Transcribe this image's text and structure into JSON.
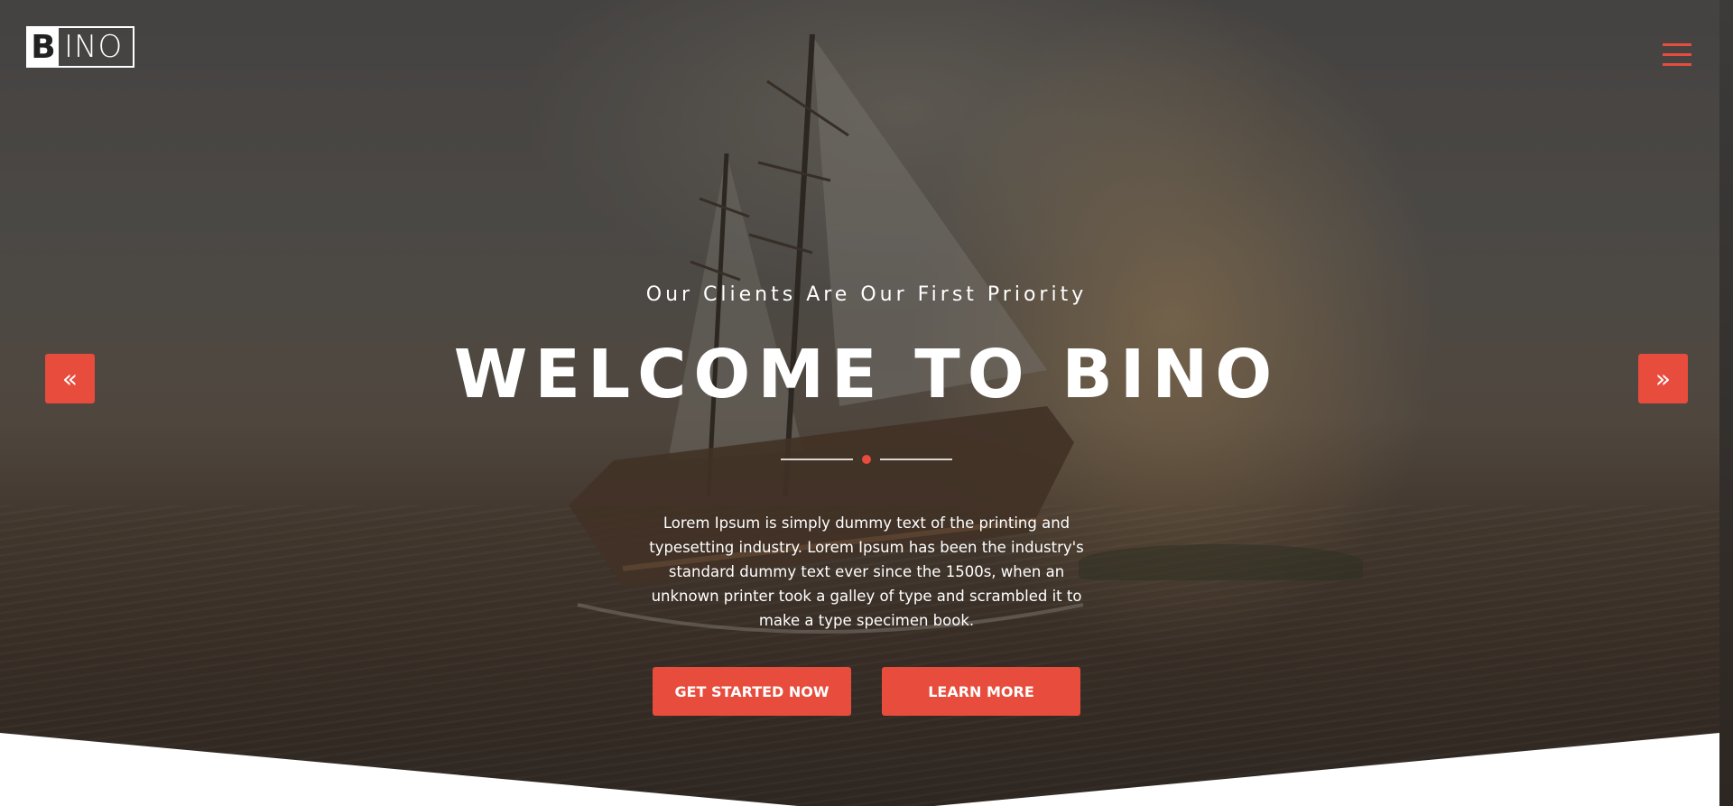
{
  "brand": {
    "logo_letter": "B",
    "logo_rest": "INO"
  },
  "nav": {
    "menu_icon": "hamburger-icon"
  },
  "slider": {
    "prev_icon": "double-chevron-left-icon",
    "next_icon": "double-chevron-right-icon",
    "prev_glyph": "«",
    "next_glyph": "»"
  },
  "hero": {
    "subtitle": "Our Clients Are Our First Priority",
    "title": "WELCOME TO BINO",
    "description": "Lorem Ipsum is simply dummy text of the printing and typesetting industry. Lorem Ipsum has been the industry's standard dummy text ever since the 1500s, when an unknown printer took a galley of type and scrambled it to make a type specimen book.",
    "primary_cta": "GET STARTED NOW",
    "secondary_cta": "LEARN MORE"
  },
  "colors": {
    "accent": "#e74c3c",
    "text": "#ffffff"
  }
}
